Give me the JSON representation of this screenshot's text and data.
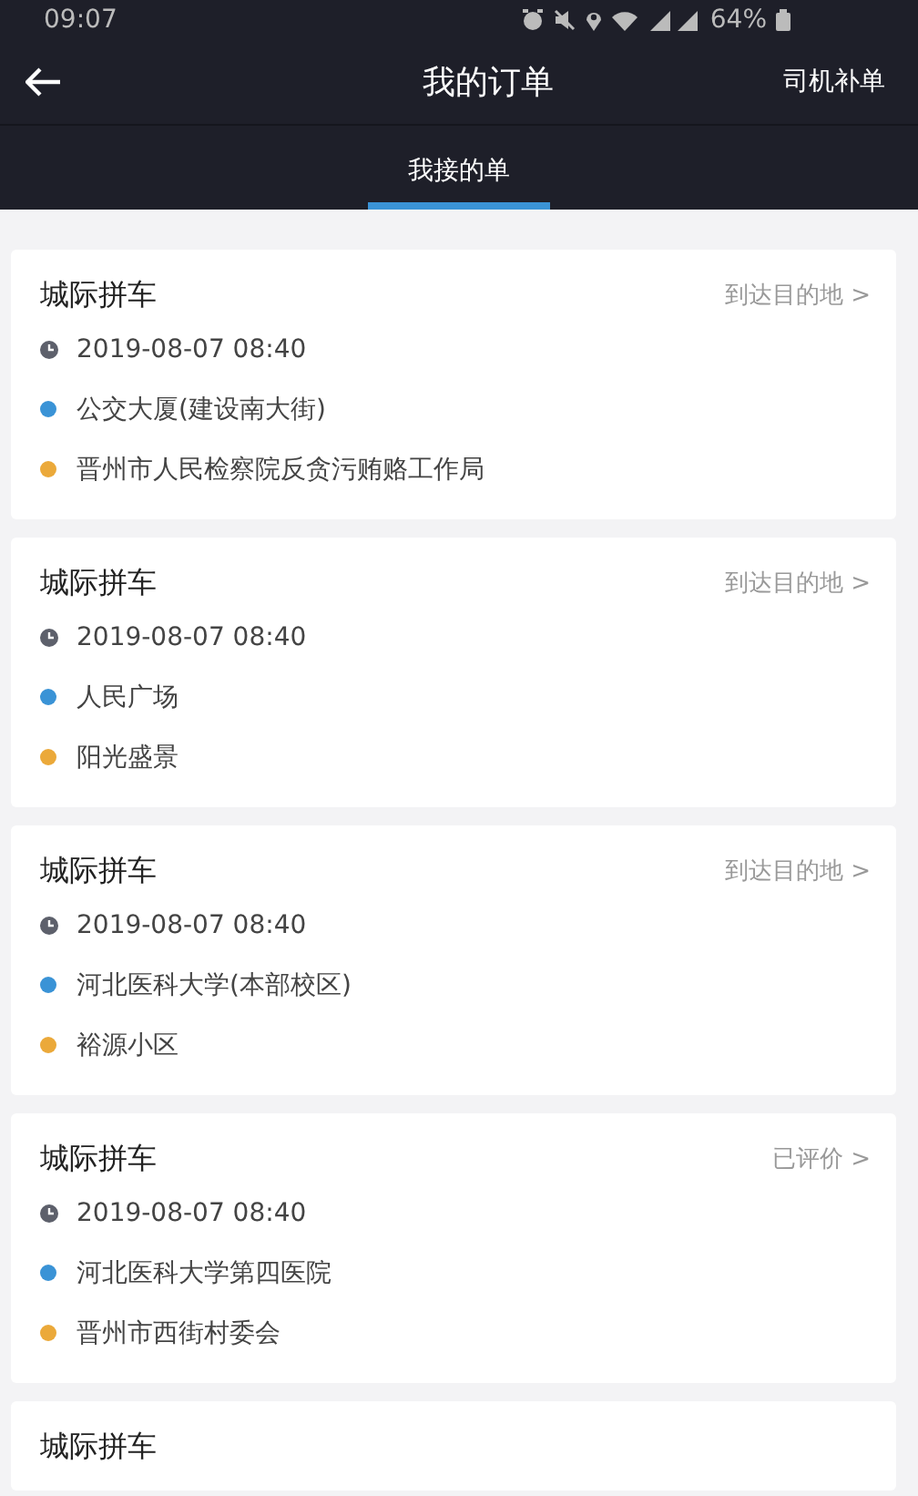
{
  "status_bar": {
    "time": "09:07",
    "battery": "64%"
  },
  "header": {
    "title": "我的订单",
    "action": "司机补单"
  },
  "tabs": [
    {
      "label": "我接的单",
      "selected": true
    }
  ],
  "orders": [
    {
      "type": "城际拼车",
      "status": "到达目的地 >",
      "time": "2019-08-07 08:40",
      "from": "公交大厦(建设南大街)",
      "to": "晋州市人民检察院反贪污贿赂工作局"
    },
    {
      "type": "城际拼车",
      "status": "到达目的地 >",
      "time": "2019-08-07 08:40",
      "from": "人民广场",
      "to": "阳光盛景"
    },
    {
      "type": "城际拼车",
      "status": "到达目的地 >",
      "time": "2019-08-07 08:40",
      "from": "河北医科大学(本部校区)",
      "to": "裕源小区"
    },
    {
      "type": "城际拼车",
      "status": "已评价 >",
      "time": "2019-08-07 08:40",
      "from": "河北医科大学第四医院",
      "to": "晋州市西街村委会"
    },
    {
      "type": "城际拼车"
    }
  ]
}
